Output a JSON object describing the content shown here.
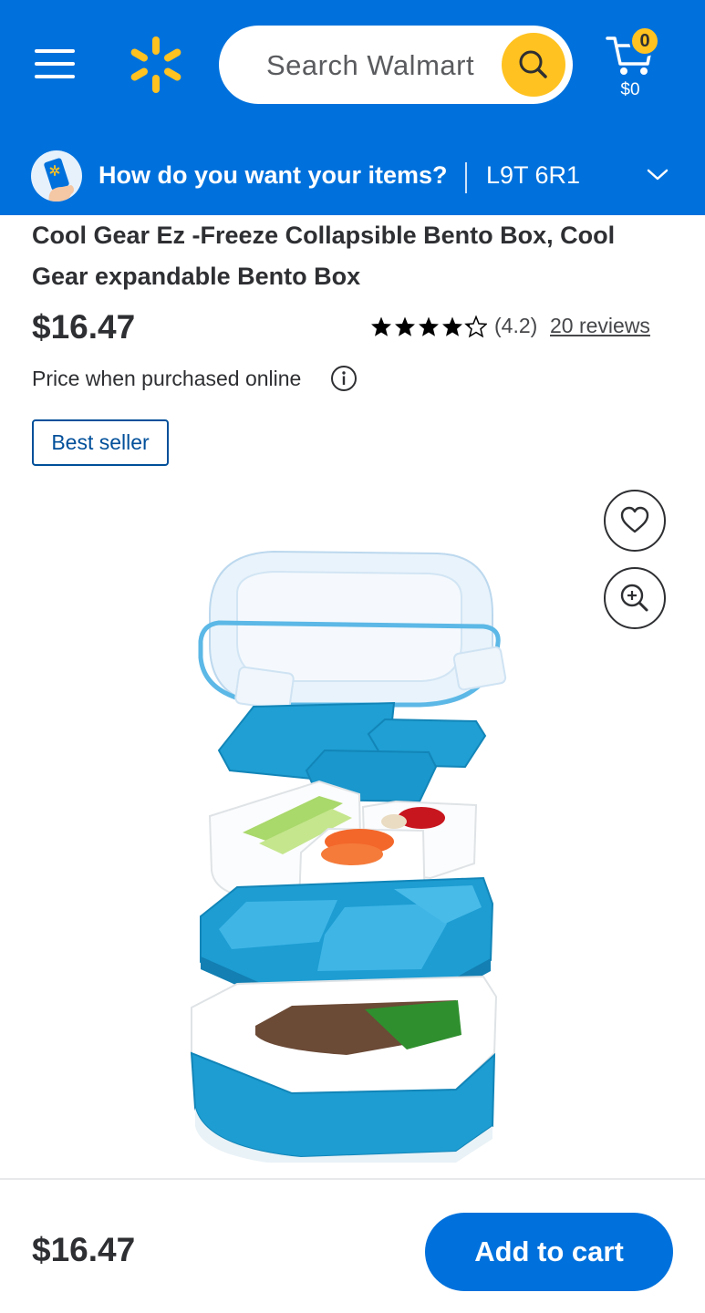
{
  "header": {
    "search_placeholder": "Search Walmart",
    "cart_count": "0",
    "cart_total": "$0",
    "brand_color": "#0071dc",
    "accent_color": "#ffc220"
  },
  "delivery": {
    "question": "How do you want your items?",
    "postal_code": "L9T 6R1"
  },
  "product": {
    "title": "Cool Gear Ez -Freeze Collapsible Bento Box, Cool Gear expandable Bento Box",
    "price": "$16.47",
    "rating": 4.2,
    "rating_text": "(4.2)",
    "reviews_link": "20 reviews",
    "price_note": "Price when purchased online",
    "badge": "Best seller"
  },
  "icons": {
    "menu": "hamburger-icon",
    "logo": "walmart-spark-icon",
    "search": "search-icon",
    "cart": "cart-icon",
    "delivery": "phone-hand-icon",
    "chevron": "chevron-down-icon",
    "info": "info-icon",
    "favorite": "heart-icon",
    "zoom": "zoom-in-icon"
  },
  "footer": {
    "price": "$16.47",
    "add_to_cart_label": "Add to cart"
  }
}
